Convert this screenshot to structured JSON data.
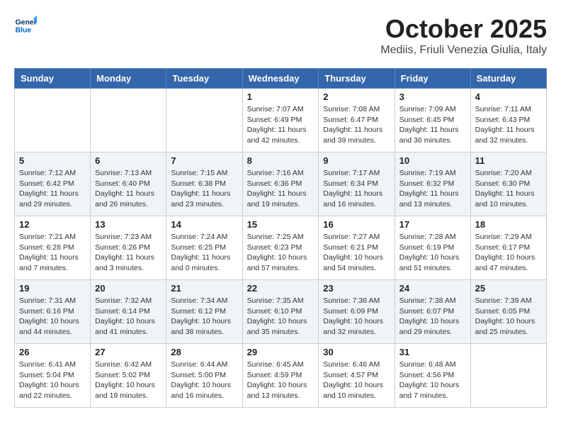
{
  "header": {
    "logo_text_general": "General",
    "logo_text_blue": "Blue",
    "month_title": "October 2025",
    "location": "Mediis, Friuli Venezia Giulia, Italy"
  },
  "days_of_week": [
    "Sunday",
    "Monday",
    "Tuesday",
    "Wednesday",
    "Thursday",
    "Friday",
    "Saturday"
  ],
  "weeks": [
    [
      {
        "day": "",
        "info": ""
      },
      {
        "day": "",
        "info": ""
      },
      {
        "day": "",
        "info": ""
      },
      {
        "day": "1",
        "info": "Sunrise: 7:07 AM\nSunset: 6:49 PM\nDaylight: 11 hours and 42 minutes."
      },
      {
        "day": "2",
        "info": "Sunrise: 7:08 AM\nSunset: 6:47 PM\nDaylight: 11 hours and 39 minutes."
      },
      {
        "day": "3",
        "info": "Sunrise: 7:09 AM\nSunset: 6:45 PM\nDaylight: 11 hours and 36 minutes."
      },
      {
        "day": "4",
        "info": "Sunrise: 7:11 AM\nSunset: 6:43 PM\nDaylight: 11 hours and 32 minutes."
      }
    ],
    [
      {
        "day": "5",
        "info": "Sunrise: 7:12 AM\nSunset: 6:42 PM\nDaylight: 11 hours and 29 minutes."
      },
      {
        "day": "6",
        "info": "Sunrise: 7:13 AM\nSunset: 6:40 PM\nDaylight: 11 hours and 26 minutes."
      },
      {
        "day": "7",
        "info": "Sunrise: 7:15 AM\nSunset: 6:38 PM\nDaylight: 11 hours and 23 minutes."
      },
      {
        "day": "8",
        "info": "Sunrise: 7:16 AM\nSunset: 6:36 PM\nDaylight: 11 hours and 19 minutes."
      },
      {
        "day": "9",
        "info": "Sunrise: 7:17 AM\nSunset: 6:34 PM\nDaylight: 11 hours and 16 minutes."
      },
      {
        "day": "10",
        "info": "Sunrise: 7:19 AM\nSunset: 6:32 PM\nDaylight: 11 hours and 13 minutes."
      },
      {
        "day": "11",
        "info": "Sunrise: 7:20 AM\nSunset: 6:30 PM\nDaylight: 11 hours and 10 minutes."
      }
    ],
    [
      {
        "day": "12",
        "info": "Sunrise: 7:21 AM\nSunset: 6:28 PM\nDaylight: 11 hours and 7 minutes."
      },
      {
        "day": "13",
        "info": "Sunrise: 7:23 AM\nSunset: 6:26 PM\nDaylight: 11 hours and 3 minutes."
      },
      {
        "day": "14",
        "info": "Sunrise: 7:24 AM\nSunset: 6:25 PM\nDaylight: 11 hours and 0 minutes."
      },
      {
        "day": "15",
        "info": "Sunrise: 7:25 AM\nSunset: 6:23 PM\nDaylight: 10 hours and 57 minutes."
      },
      {
        "day": "16",
        "info": "Sunrise: 7:27 AM\nSunset: 6:21 PM\nDaylight: 10 hours and 54 minutes."
      },
      {
        "day": "17",
        "info": "Sunrise: 7:28 AM\nSunset: 6:19 PM\nDaylight: 10 hours and 51 minutes."
      },
      {
        "day": "18",
        "info": "Sunrise: 7:29 AM\nSunset: 6:17 PM\nDaylight: 10 hours and 47 minutes."
      }
    ],
    [
      {
        "day": "19",
        "info": "Sunrise: 7:31 AM\nSunset: 6:16 PM\nDaylight: 10 hours and 44 minutes."
      },
      {
        "day": "20",
        "info": "Sunrise: 7:32 AM\nSunset: 6:14 PM\nDaylight: 10 hours and 41 minutes."
      },
      {
        "day": "21",
        "info": "Sunrise: 7:34 AM\nSunset: 6:12 PM\nDaylight: 10 hours and 38 minutes."
      },
      {
        "day": "22",
        "info": "Sunrise: 7:35 AM\nSunset: 6:10 PM\nDaylight: 10 hours and 35 minutes."
      },
      {
        "day": "23",
        "info": "Sunrise: 7:36 AM\nSunset: 6:09 PM\nDaylight: 10 hours and 32 minutes."
      },
      {
        "day": "24",
        "info": "Sunrise: 7:38 AM\nSunset: 6:07 PM\nDaylight: 10 hours and 29 minutes."
      },
      {
        "day": "25",
        "info": "Sunrise: 7:39 AM\nSunset: 6:05 PM\nDaylight: 10 hours and 25 minutes."
      }
    ],
    [
      {
        "day": "26",
        "info": "Sunrise: 6:41 AM\nSunset: 5:04 PM\nDaylight: 10 hours and 22 minutes."
      },
      {
        "day": "27",
        "info": "Sunrise: 6:42 AM\nSunset: 5:02 PM\nDaylight: 10 hours and 19 minutes."
      },
      {
        "day": "28",
        "info": "Sunrise: 6:44 AM\nSunset: 5:00 PM\nDaylight: 10 hours and 16 minutes."
      },
      {
        "day": "29",
        "info": "Sunrise: 6:45 AM\nSunset: 4:59 PM\nDaylight: 10 hours and 13 minutes."
      },
      {
        "day": "30",
        "info": "Sunrise: 6:46 AM\nSunset: 4:57 PM\nDaylight: 10 hours and 10 minutes."
      },
      {
        "day": "31",
        "info": "Sunrise: 6:48 AM\nSunset: 4:56 PM\nDaylight: 10 hours and 7 minutes."
      },
      {
        "day": "",
        "info": ""
      }
    ]
  ]
}
